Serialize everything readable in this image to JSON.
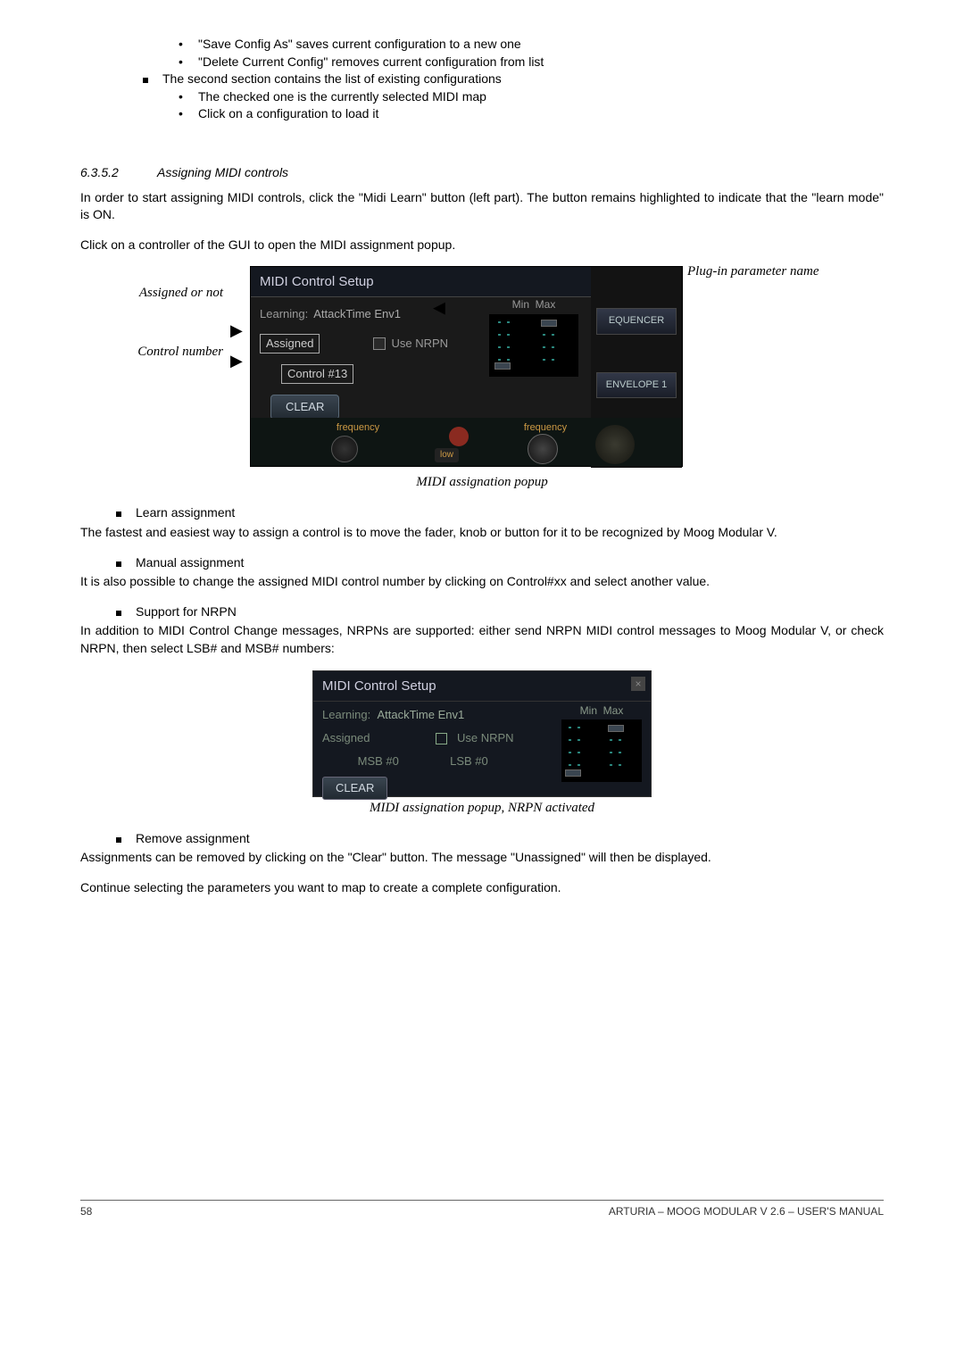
{
  "topBullets": {
    "l2a": "\"Save Config As\" saves current configuration to a new one",
    "l2b": "\"Delete Current Config\" removes current configuration from list",
    "l1a": "The second section contains the list of existing configurations",
    "l2c": "The checked one is the currently selected MIDI map",
    "l2d": "Click on a configuration to load it"
  },
  "section": {
    "num": "6.3.5.2",
    "title": "Assigning MIDI controls"
  },
  "p1": "In order to start assigning MIDI controls, click the \"Midi Learn\" button (left part). The button remains highlighted to indicate that the \"learn mode\" is ON.",
  "p2": "Click on a controller of the GUI to open the MIDI assignment popup.",
  "fig1": {
    "label_assigned": "Assigned or not",
    "label_control": "Control number",
    "label_plugin": "Plug-in parameter name",
    "title": "MIDI Control Setup",
    "learning": "Learning:",
    "paramName": "AttackTime Env1",
    "assigned": "Assigned",
    "useNrpn": "Use NRPN",
    "controlNum": "Control #13",
    "clear": "CLEAR",
    "min": "Min",
    "max": "Max",
    "equencer": "EQUENCER",
    "envelope": "ENVELOPE 1",
    "frequency": "frequency",
    "low": "low",
    "caption": "MIDI assignation popup"
  },
  "learn": {
    "head": "Learn assignment",
    "text": "The fastest and easiest way to assign a control is to move the fader, knob or button for it to be recognized by Moog Modular V."
  },
  "manual": {
    "head": "Manual assignment",
    "text": "It is also possible to change the assigned MIDI control number by clicking on Control#xx and select another value."
  },
  "nrpn": {
    "head": "Support for NRPN",
    "text": "In addition to MIDI Control Change messages, NRPNs are supported: either send NRPN MIDI control messages to Moog Modular V, or check NRPN, then select LSB# and MSB# numbers:"
  },
  "fig2": {
    "title": "MIDI Control Setup",
    "learning": "Learning:",
    "paramName": "AttackTime Env1",
    "assigned": "Assigned",
    "useNrpn": "Use NRPN",
    "msb": "MSB #0",
    "lsb": "LSB #0",
    "clear": "CLEAR",
    "min": "Min",
    "max": "Max",
    "caption": "MIDI assignation popup, NRPN activated"
  },
  "remove": {
    "head": "Remove assignment",
    "text": "Assignments can be removed by clicking on the \"Clear\" button. The message \"Unassigned\" will then be displayed."
  },
  "p_last": "Continue selecting the parameters you want to map to create a complete configuration.",
  "footer": {
    "page": "58",
    "doc": "ARTURIA – MOOG MODULAR V 2.6 – USER'S MANUAL"
  }
}
